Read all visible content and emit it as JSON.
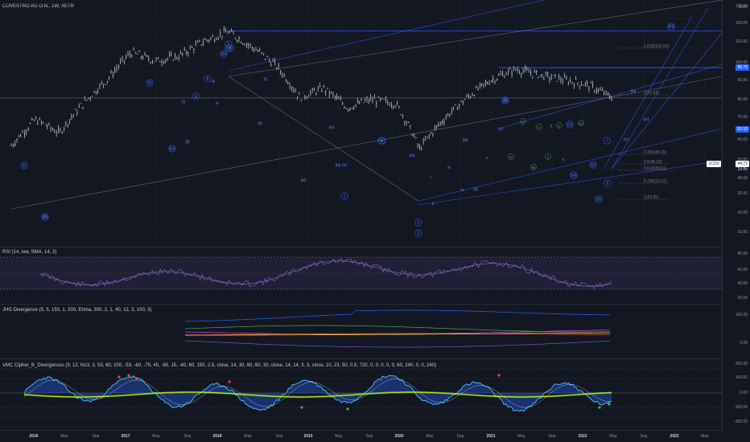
{
  "header": {
    "symbol": "COVESTRO AG O.N., 1W, XETR",
    "currency": "EUR"
  },
  "price_axis": {
    "ticks": [
      "130.00",
      "120.00",
      "110.00",
      "100.00",
      "90.00",
      "80.00",
      "70.00",
      "60.00",
      "50.00",
      "40.00",
      "30.00",
      "20.00",
      "10.00"
    ],
    "badge_high": "95.76",
    "badge_mid": "63.10",
    "badge_sym": "1COV",
    "badge_last": "44.72",
    "badge_time": "2d 8h"
  },
  "panes": {
    "rsi": {
      "title": "RSI (14, low, SMA, 14, 2)",
      "ticks": [
        "80.00",
        "60.00",
        "40.00",
        "20.00"
      ]
    },
    "jhg": {
      "title": "JHG Divergence (5, 5, 150, 1, 200, Ehma, 300, 2, 1, 40, 12, 3, 100, 3)",
      "ticks": [
        "100.00",
        "0.00"
      ]
    },
    "vmc": {
      "title": "VMC Cipher_B_Divergences (9, 12, hlc3, 3, 53, 60, 100, -53, -60, -75, 45, -65, 15, -40, 60, 150, 2.5, close, 14, 30, 60, 60, 30, close, 14, 14, 3, 3, close, 10, 23, 50, 0.5, 720, 0, 0, 0, 0, 0, 60, 240, 0, 0, 240)",
      "ticks": [
        "200.00",
        "100.00",
        "0.00",
        "-100.00",
        "-200.00"
      ]
    }
  },
  "time_axis": {
    "labels": [
      {
        "t": "2016",
        "major": true
      },
      {
        "t": "May",
        "major": false
      },
      {
        "t": "Sep",
        "major": false
      },
      {
        "t": "2017",
        "major": true
      },
      {
        "t": "May",
        "major": false
      },
      {
        "t": "Sep",
        "major": false
      },
      {
        "t": "2018",
        "major": true
      },
      {
        "t": "May",
        "major": false
      },
      {
        "t": "Sep",
        "major": false
      },
      {
        "t": "2019",
        "major": true
      },
      {
        "t": "May",
        "major": false
      },
      {
        "t": "Sep",
        "major": false
      },
      {
        "t": "2020",
        "major": true
      },
      {
        "t": "May",
        "major": false
      },
      {
        "t": "Sep",
        "major": false
      },
      {
        "t": "2021",
        "major": true
      },
      {
        "t": "May",
        "major": false
      },
      {
        "t": "Sep",
        "major": false
      },
      {
        "t": "2022",
        "major": true
      },
      {
        "t": "May",
        "major": false
      },
      {
        "t": "Sep",
        "major": false
      },
      {
        "t": "2023",
        "major": true
      },
      {
        "t": "May",
        "major": false
      }
    ]
  },
  "annotations": {
    "fib": [
      "1.618(103.20)",
      "1(76.93)",
      "0.382(48.15)",
      "0.5(45.02)",
      "0.618(39.51)",
      "0.786(32.07)",
      "1(22.55)"
    ],
    "waves_major": [
      "1",
      "2",
      "(I)",
      "(II)",
      "(III)"
    ],
    "waves_minor": [
      "i",
      "ii",
      "iii",
      "iv",
      "v",
      "(i)",
      "(ii)",
      "(iii)",
      "(iv)",
      "(v)",
      "a",
      "b",
      "c",
      "w",
      "x",
      "y"
    ]
  },
  "chart_data": {
    "type": "line",
    "title": "COVESTRO AG O.N., 1W, XETR",
    "x": [
      "2016-01",
      "2016-04",
      "2016-07",
      "2016-10",
      "2017-01",
      "2017-04",
      "2017-07",
      "2017-10",
      "2018-01",
      "2018-04",
      "2018-07",
      "2018-10",
      "2019-01",
      "2019-04",
      "2019-07",
      "2019-10",
      "2020-01",
      "2020-03",
      "2020-06",
      "2020-09",
      "2021-01",
      "2021-04",
      "2021-07",
      "2021-10",
      "2022-01",
      "2022-03"
    ],
    "series": [
      {
        "values": [
          26,
          35,
          30,
          42,
          55,
          75,
          68,
          72,
          85,
          95,
          80,
          65,
          45,
          50,
          40,
          44,
          42,
          25,
          35,
          45,
          55,
          62,
          58,
          55,
          52,
          45
        ]
      }
    ],
    "ylim": [
      10,
      135
    ],
    "scale": "log",
    "levels": [
      95.76,
      63.1,
      44.72
    ]
  }
}
